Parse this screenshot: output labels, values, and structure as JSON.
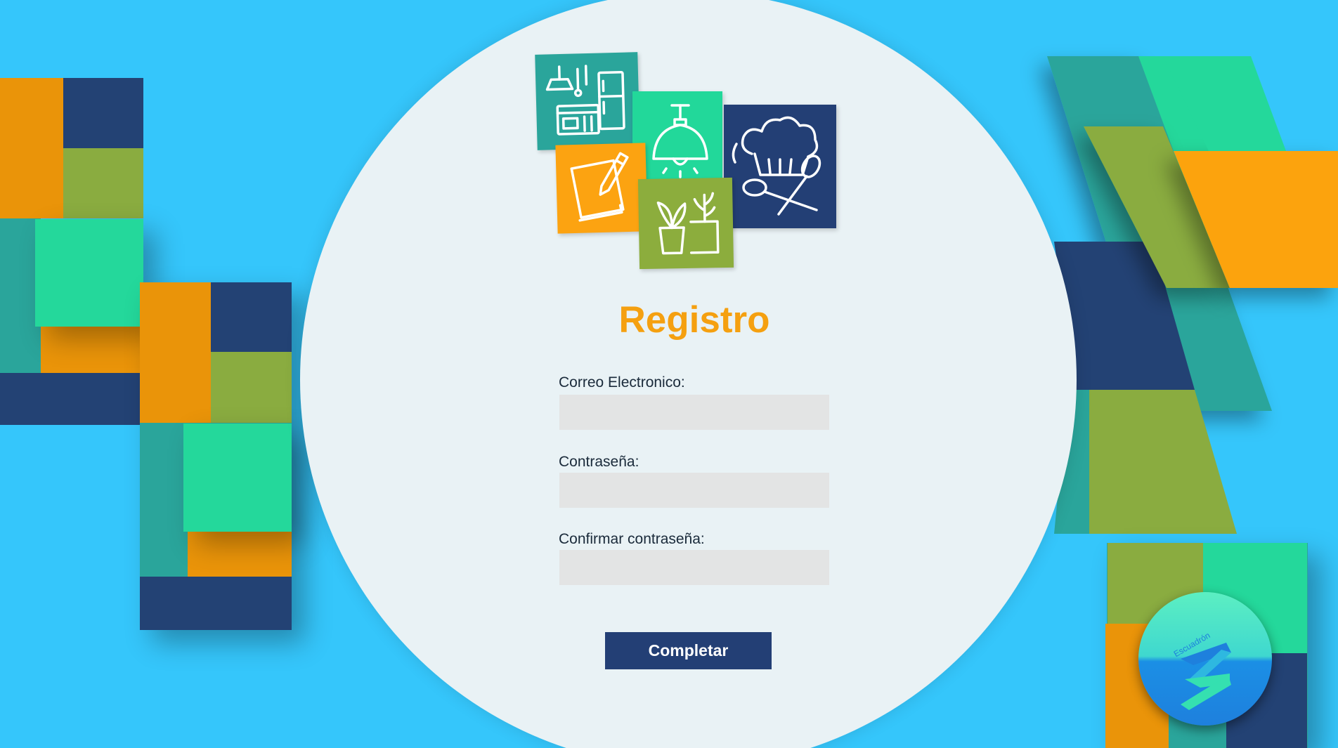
{
  "form": {
    "title": "Registro",
    "email_label": "Correo Electronico:",
    "email_value": "",
    "password_label": "Contraseña:",
    "password_value": "",
    "confirm_label": "Confirmar contraseña:",
    "confirm_value": "",
    "submit_label": "Completar"
  },
  "logo_tiles": [
    {
      "icon": "kitchen-icon",
      "color": "#2aa59b"
    },
    {
      "icon": "ceiling-lamp-icon",
      "color": "#22d89a"
    },
    {
      "icon": "chef-hat-spoons-icon",
      "color": "#233f75"
    },
    {
      "icon": "notes-pencil-icon",
      "color": "#fca311"
    },
    {
      "icon": "potted-plants-icon",
      "color": "#8cad3d"
    }
  ],
  "brand": {
    "icon": "brand-logo-icon",
    "text": "Escuadrón"
  },
  "colors": {
    "background": "#35c6fb",
    "circle": "#e9f2f5",
    "accent_orange": "#f5a010",
    "navy": "#233f75",
    "teal": "#2aa59b",
    "green": "#22d89a",
    "olive": "#8cad3d",
    "input": "#e3e4e4"
  }
}
